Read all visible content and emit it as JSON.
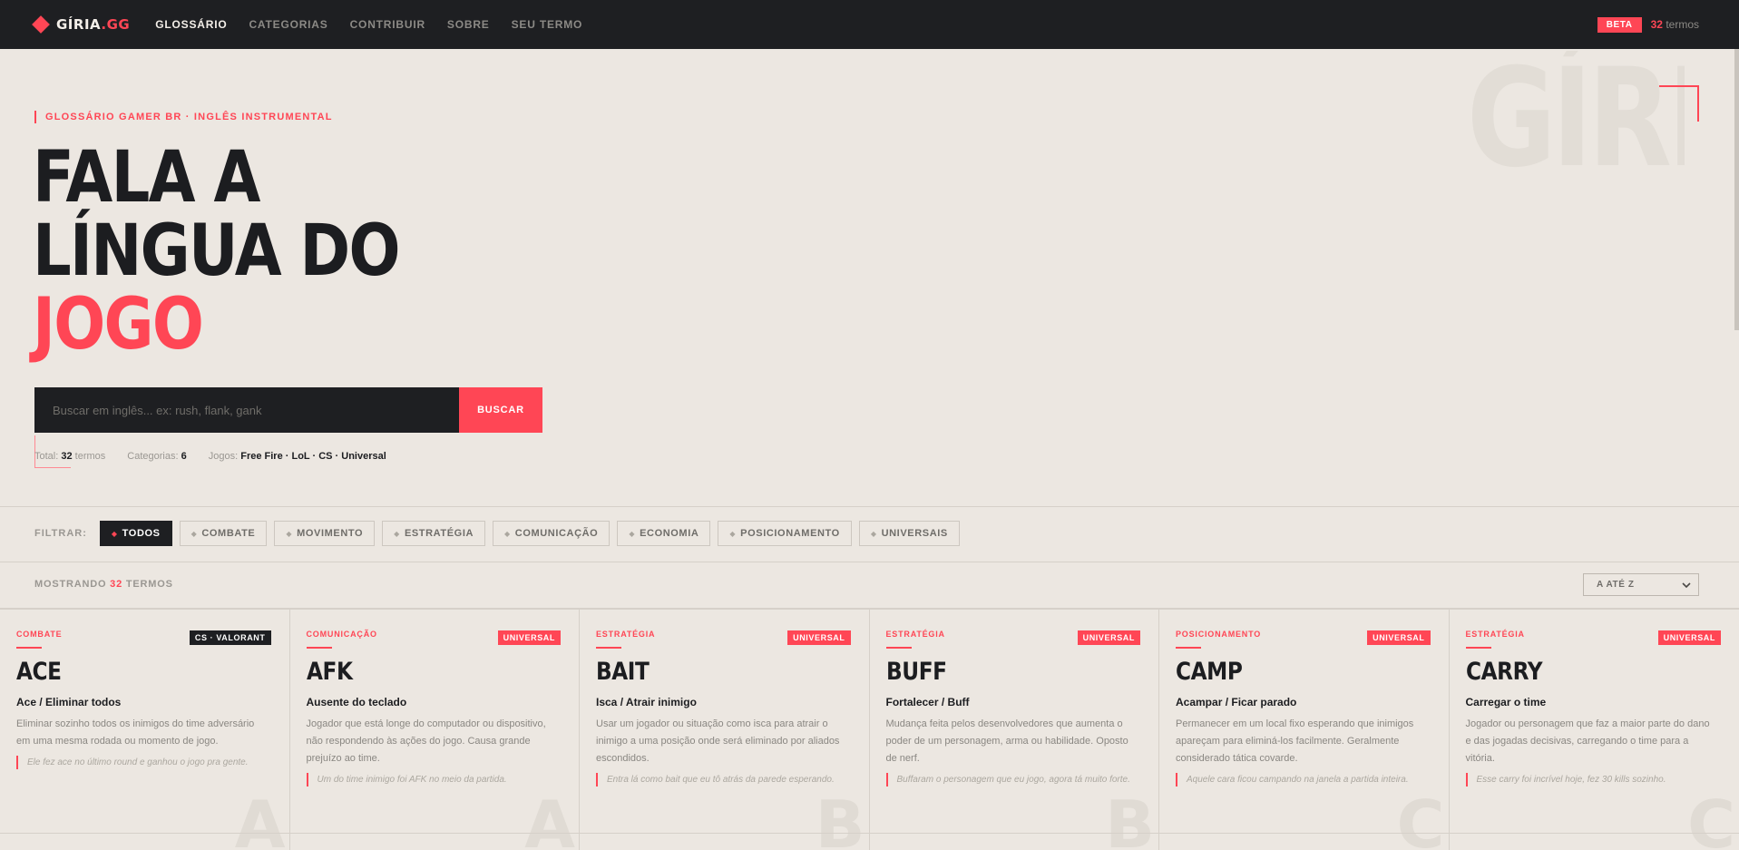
{
  "nav": {
    "logo_main": "GÍRIA",
    "logo_suffix": ".GG",
    "links": [
      {
        "label": "GLOSSÁRIO",
        "active": true
      },
      {
        "label": "CATEGORIAS",
        "active": false
      },
      {
        "label": "CONTRIBUIR",
        "active": false
      },
      {
        "label": "SOBRE",
        "active": false
      },
      {
        "label": "SEU TERMO",
        "active": false
      }
    ],
    "badge": "BETA",
    "count_value": "32",
    "count_label": "termos"
  },
  "hero": {
    "bg_word": "GÍRIA",
    "eyebrow": "GLOSSÁRIO GAMER BR · INGLÊS INSTRUMENTAL",
    "title_line1": "FALA A",
    "title_line2": "LÍNGUA DO",
    "title_line3": "JOGO",
    "search_placeholder": "Buscar em inglês... ex: rush, flank, gank",
    "search_button": "BUSCAR",
    "stats": {
      "total_label": "Total:",
      "total_value": "32",
      "total_suffix": "termos",
      "categories_label": "Categorias:",
      "categories_value": "6",
      "games_label": "Jogos:",
      "games_value": "Free Fire · LoL · CS · Universal"
    }
  },
  "filters": {
    "label": "FILTRAR:",
    "chips": [
      {
        "label": "TODOS",
        "active": true
      },
      {
        "label": "COMBATE",
        "active": false
      },
      {
        "label": "MOVIMENTO",
        "active": false
      },
      {
        "label": "ESTRATÉGIA",
        "active": false
      },
      {
        "label": "COMUNICAÇÃO",
        "active": false
      },
      {
        "label": "ECONOMIA",
        "active": false
      },
      {
        "label": "POSICIONAMENTO",
        "active": false
      },
      {
        "label": "UNIVERSAIS",
        "active": false
      }
    ]
  },
  "results": {
    "prefix": "MOSTRANDO",
    "count": "32",
    "suffix": "TERMOS",
    "sort_value": "A ATÉ Z"
  },
  "cards": [
    {
      "category": "COMBATE",
      "tag": "CS · VALORANT",
      "tag_dark": true,
      "term": "ACE",
      "translation": "Ace / Eliminar todos",
      "description": "Eliminar sozinho todos os inimigos do time adversário em uma mesma rodada ou momento de jogo.",
      "example": "Ele fez ace no último round e ganhou o jogo pra gente.",
      "letter": "A"
    },
    {
      "category": "COMUNICAÇÃO",
      "tag": "UNIVERSAL",
      "tag_dark": false,
      "term": "AFK",
      "translation": "Ausente do teclado",
      "description": "Jogador que está longe do computador ou dispositivo, não respondendo às ações do jogo. Causa grande prejuízo ao time.",
      "example": "Um do time inimigo foi AFK no meio da partida.",
      "letter": "A"
    },
    {
      "category": "ESTRATÉGIA",
      "tag": "UNIVERSAL",
      "tag_dark": false,
      "term": "BAIT",
      "translation": "Isca / Atrair inimigo",
      "description": "Usar um jogador ou situação como isca para atrair o inimigo a uma posição onde será eliminado por aliados escondidos.",
      "example": "Entra lá como bait que eu tô atrás da parede esperando.",
      "letter": "B"
    },
    {
      "category": "ESTRATÉGIA",
      "tag": "UNIVERSAL",
      "tag_dark": false,
      "term": "BUFF",
      "translation": "Fortalecer / Buff",
      "description": "Mudança feita pelos desenvolvedores que aumenta o poder de um personagem, arma ou habilidade. Oposto de nerf.",
      "example": "Buffaram o personagem que eu jogo, agora tá muito forte.",
      "letter": "B"
    },
    {
      "category": "POSICIONAMENTO",
      "tag": "UNIVERSAL",
      "tag_dark": false,
      "term": "CAMP",
      "translation": "Acampar / Ficar parado",
      "description": "Permanecer em um local fixo esperando que inimigos apareçam para eliminá-los facilmente. Geralmente considerado tática covarde.",
      "example": "Aquele cara ficou campando na janela a partida inteira.",
      "letter": "C"
    },
    {
      "category": "ESTRATÉGIA",
      "tag": "UNIVERSAL",
      "tag_dark": false,
      "term": "CARRY",
      "translation": "Carregar o time",
      "description": "Jogador ou personagem que faz a maior parte do dano e das jogadas decisivas, carregando o time para a vitória.",
      "example": "Esse carry foi incrível hoje, fez 30 kills sozinho.",
      "letter": "C"
    }
  ],
  "colors": {
    "accent": "#ff4655",
    "dark": "#1e1f22",
    "background": "#ece7e1"
  }
}
